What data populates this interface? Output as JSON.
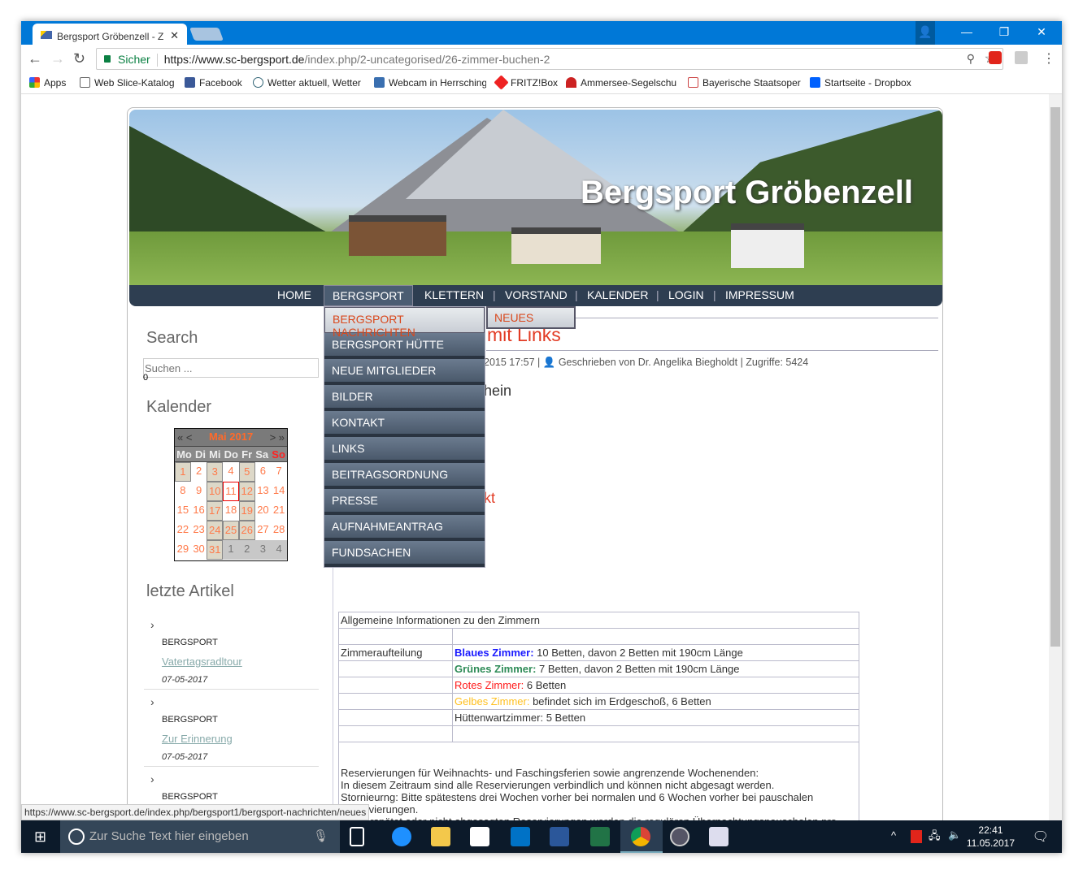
{
  "browser": {
    "tab_title": "Bergsport Gröbenzell - Z",
    "secure_label": "Sicher",
    "url_domain": "https://www.sc-bergsport.de",
    "url_path": "/index.php/2-uncategorised/26-zimmer-buchen-2",
    "bookmarks": [
      "Apps",
      "Web Slice-Katalog",
      "Facebook",
      "Wetter aktuell, Wetter",
      "Webcam in Herrsching",
      "FRITZ!Box",
      "Ammersee-Segelschu",
      "Bayerische Staatsoper",
      "Startseite - Dropbox"
    ],
    "status_url": "https://www.sc-bergsport.de/index.php/bergsport1/bergsport-nachrichten/neues"
  },
  "site": {
    "title": "Bergsport Gröbenzell",
    "nav": [
      "HOME",
      "BERGSPORT",
      "KLETTERN",
      "VORSTAND",
      "KALENDER",
      "LOGIN",
      "IMPRESSUM"
    ],
    "dropdown": [
      "BERGSPORT NACHRICHTEN",
      "BERGSPORT HÜTTE",
      "NEUE MITGLIEDER",
      "BILDER",
      "KONTAKT",
      "LINKS",
      "BEITRAGSORDNUNG",
      "PRESSE",
      "AUFNAHMEANTRAG",
      "FUNDSACHEN"
    ],
    "submenu": "NEUES"
  },
  "sidebar": {
    "search_heading": "Search",
    "search_placeholder": "Suchen ...",
    "search_count": "0",
    "calendar_heading": "Kalender",
    "calendar": {
      "prev": "« <",
      "month": "Mai 2017",
      "next": "> »",
      "weekdays": [
        "Mo",
        "Di",
        "Mi",
        "Do",
        "Fr",
        "Sa",
        "So"
      ],
      "days": [
        "1",
        "2",
        "3",
        "4",
        "5",
        "6",
        "7",
        "8",
        "9",
        "10",
        "11",
        "12",
        "13",
        "14",
        "15",
        "16",
        "17",
        "18",
        "19",
        "20",
        "21",
        "22",
        "23",
        "24",
        "25",
        "26",
        "27",
        "28",
        "29",
        "30",
        "31",
        "1",
        "2",
        "3",
        "4"
      ],
      "event_days": [
        1,
        3,
        5,
        10,
        12,
        17,
        19,
        24,
        25,
        26,
        31
      ],
      "today": 11
    },
    "articles_heading": "letzte Artikel",
    "articles": [
      {
        "category": "BERGSPORT",
        "title": "Vatertagsradltour",
        "date": "07-05-2017"
      },
      {
        "category": "BERGSPORT",
        "title": "Zur Erinnerung",
        "date": "07-05-2017"
      },
      {
        "category": "BERGSPORT"
      }
    ]
  },
  "main": {
    "title_fragment": "mit Links",
    "meta_date": "2015 17:57 |",
    "meta_author": "Geschrieben von Dr. Angelika Biegholdt | Zugriffe: 5424",
    "fragment1": "hein",
    "fragment2": "kt",
    "table": {
      "header": "Allgemeine Informationen zu den Zimmern",
      "label": "Zimmeraufteilung",
      "rows": [
        {
          "name": "Blaues Zimmer:",
          "text": " 10 Betten, davon 2 Betten mit 190cm Länge",
          "color": "#1a1aff"
        },
        {
          "name": "Grünes Zimmer:",
          "text": " 7 Betten, davon 2 Betten mit 190cm Länge",
          "color": "#2e8b57"
        },
        {
          "name": "Rotes Zimmer:",
          "text": " 6 Betten",
          "color": "#ff1a1a"
        },
        {
          "name": "Gelbes Zimmer:",
          "text": " befindet sich im Erdgeschoß, 6 Betten",
          "color": "#ffc020"
        },
        {
          "name": "",
          "text": "Hüttenwartzimmer: 5 Betten",
          "color": "#333333"
        }
      ],
      "paragraph": [
        "Reservierungen für Weihnachts- und Faschingsferien sowie angrenzende Wochenenden:",
        "In diesem Zeitraum sind alle Reservierungen verbindlich und können nicht abgesagt werden.",
        "Stornieurng: Bitte spätestens drei Wochen vorher bei normalen und 6 Wochen vorher bei pauschalen",
        "Reservierungen.",
        "Bei verspätet oder nicht abgesagten Reservierungen werden die regulären Übernachtungspauschalen pro"
      ]
    }
  },
  "taskbar": {
    "search_placeholder": "Zur Suche Text hier eingeben",
    "time": "22:41",
    "date": "11.05.2017"
  }
}
